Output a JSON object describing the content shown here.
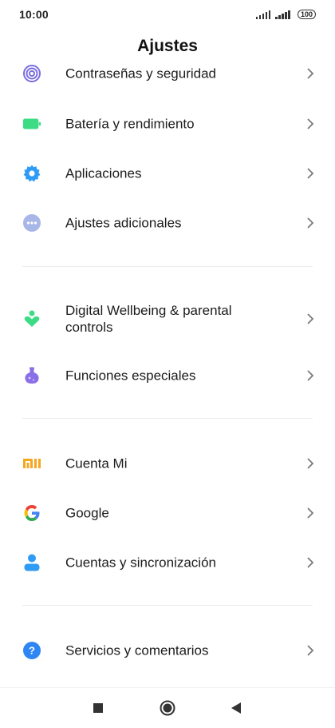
{
  "status_bar": {
    "time": "10:00",
    "battery": "100"
  },
  "header": {
    "title": "Ajustes"
  },
  "items": [
    {
      "label": "Contraseñas y seguridad",
      "icon": "fingerprint-icon",
      "color": "#7a6de0"
    },
    {
      "label": "Batería y rendimiento",
      "icon": "battery-icon",
      "color": "#3ddc84"
    },
    {
      "label": "Aplicaciones",
      "icon": "gear-icon",
      "color": "#2e9bf5"
    },
    {
      "label": "Ajustes adicionales",
      "icon": "more-dots-icon",
      "color": "#a9b7e8"
    },
    {
      "label": "Digital Wellbeing & parental controls",
      "icon": "wellbeing-icon",
      "color": "#3ddc84"
    },
    {
      "label": "Funciones especiales",
      "icon": "potion-icon",
      "color": "#8a6fe8"
    },
    {
      "label": "Cuenta Mi",
      "icon": "mi-logo-icon",
      "color": "#f5a623"
    },
    {
      "label": "Google",
      "icon": "google-logo-icon",
      "color": "#4285f4"
    },
    {
      "label": "Cuentas y sincronización",
      "icon": "person-icon",
      "color": "#2e9bf5"
    },
    {
      "label": "Servicios y comentarios",
      "icon": "help-icon",
      "color": "#2e86f5"
    }
  ]
}
